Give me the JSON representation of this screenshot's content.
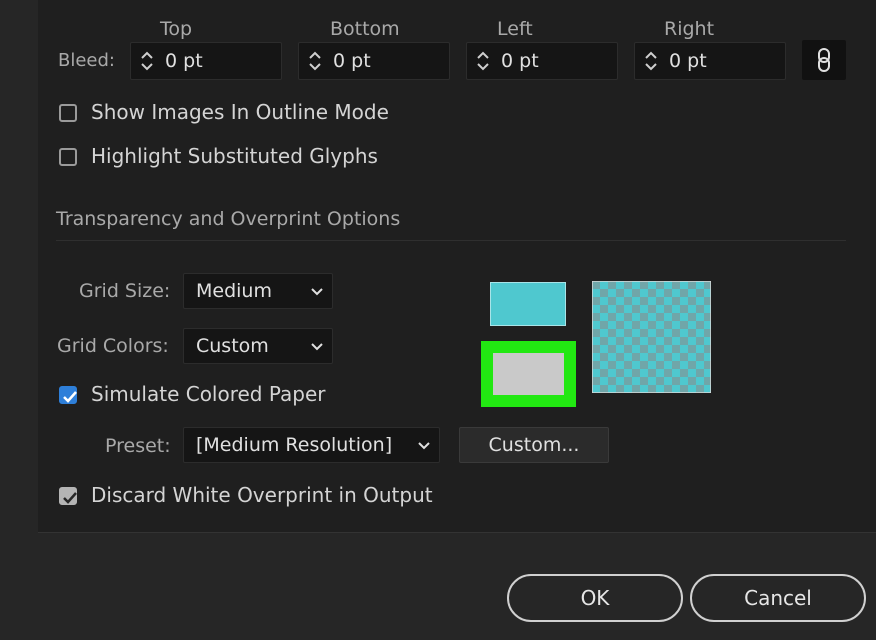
{
  "bleed": {
    "label": "Bleed:",
    "columns": [
      {
        "header": "Top",
        "value": "0 pt"
      },
      {
        "header": "Bottom",
        "value": "0 pt"
      },
      {
        "header": "Left",
        "value": "0 pt"
      },
      {
        "header": "Right",
        "value": "0 pt"
      }
    ]
  },
  "options": {
    "show_images_outline": {
      "label": "Show Images In Outline Mode",
      "checked": false
    },
    "highlight_glyphs": {
      "label": "Highlight Substituted Glyphs",
      "checked": false
    }
  },
  "transparency": {
    "title": "Transparency and Overprint Options",
    "grid_size": {
      "label": "Grid Size:",
      "value": "Medium"
    },
    "grid_colors": {
      "label": "Grid Colors:",
      "value": "Custom"
    },
    "simulate_paper": {
      "label": "Simulate Colored Paper",
      "checked": true
    },
    "preset": {
      "label": "Preset:",
      "value": "[Medium Resolution]"
    },
    "custom_button": "Custom...",
    "discard_white": {
      "label": "Discard White Overprint in Output",
      "checked": true
    },
    "swatch_colors": {
      "grid": "#4fc8cf",
      "paper_border": "#22e812",
      "paper_fill": "#c9c9c9",
      "checker_light": "#bdbdbd",
      "checker_dark": "#7d7d7d"
    }
  },
  "footer": {
    "ok": "OK",
    "cancel": "Cancel"
  }
}
